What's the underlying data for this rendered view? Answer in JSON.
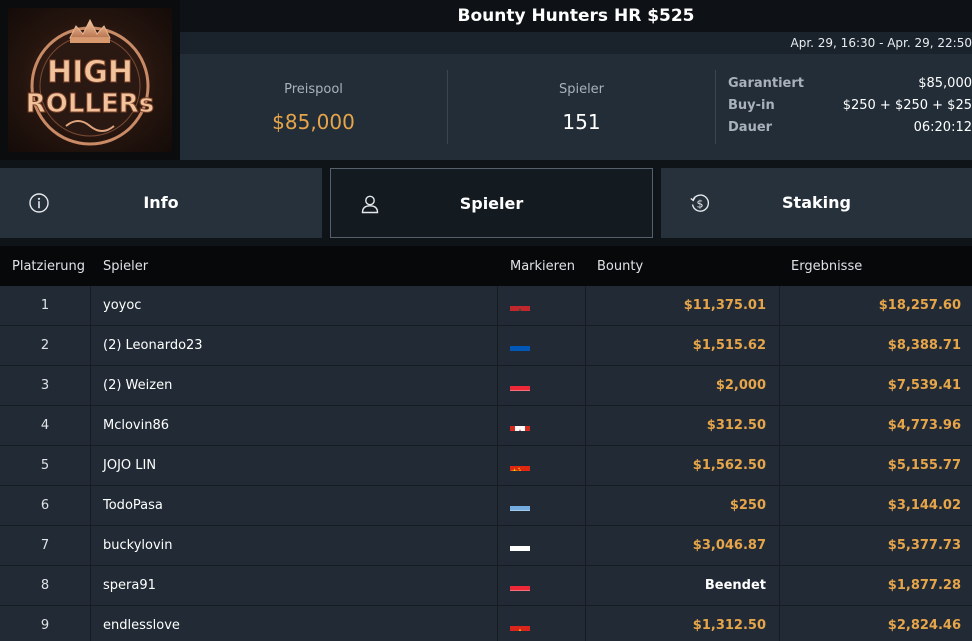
{
  "tournament": {
    "title": "Bounty Hunters HR $525",
    "dates": "Apr. 29, 16:30 - Apr. 29, 22:50",
    "logo_text_line1": "HIGH",
    "logo_text_line2": "ROLLERs"
  },
  "stats": {
    "prizepool_label": "Preispool",
    "prizepool_value": "$85,000",
    "players_label": "Spieler",
    "players_value": "151",
    "details": [
      {
        "label": "Garantiert",
        "value": "$85,000"
      },
      {
        "label": "Buy-in",
        "value": "$250 + $250 + $25"
      },
      {
        "label": "Dauer",
        "value": "06:20:12"
      }
    ]
  },
  "tabs": [
    {
      "label": "Info",
      "icon": "info-icon"
    },
    {
      "label": "Spieler",
      "icon": "user-icon"
    },
    {
      "label": "Staking",
      "icon": "dollar-cycle-icon"
    }
  ],
  "table": {
    "headers": {
      "rank": "Platzierung",
      "player": "Spieler",
      "flag": "Markieren",
      "bounty": "Bounty",
      "result": "Ergebnisse"
    },
    "rows": [
      {
        "rank": "1",
        "player": "yoyoc",
        "flag": "morocco",
        "bounty": "$11,375.01",
        "result": "$18,257.60"
      },
      {
        "rank": "2",
        "player": "(2) Leonardo23",
        "flag": "ukraine",
        "bounty": "$1,515.62",
        "result": "$8,388.71"
      },
      {
        "rank": "3",
        "player": "(2) Weizen",
        "flag": "austria",
        "bounty": "$2,000",
        "result": "$7,539.41"
      },
      {
        "rank": "4",
        "player": "Mclovin86",
        "flag": "canada",
        "bounty": "$312.50",
        "result": "$4,773.96"
      },
      {
        "rank": "5",
        "player": "JOJO LIN",
        "flag": "china",
        "bounty": "$1,562.50",
        "result": "$5,155.77"
      },
      {
        "rank": "6",
        "player": "TodoPasa",
        "flag": "argentina",
        "bounty": "$250",
        "result": "$3,144.02"
      },
      {
        "rank": "7",
        "player": "buckylovin",
        "flag": "poland",
        "bounty": "$3,046.87",
        "result": "$5,377.73"
      },
      {
        "rank": "8",
        "player": "spera91",
        "flag": "austria",
        "bounty": "Beendet",
        "result": "$1,877.28"
      },
      {
        "rank": "9",
        "player": "endlesslove",
        "flag": "vietnam",
        "bounty": "$1,312.50",
        "result": "$2,824.46"
      }
    ]
  },
  "colors": {
    "gold": "#e7a54a",
    "white": "#ffffff"
  }
}
